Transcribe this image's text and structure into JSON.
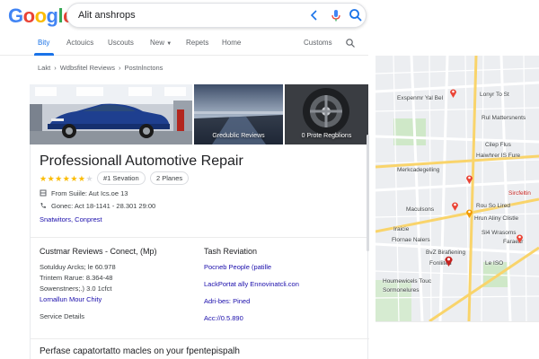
{
  "header": {
    "logo_letters": [
      {
        "char": "G",
        "color": "#4285f4"
      },
      {
        "char": "o",
        "color": "#ea4335"
      },
      {
        "char": "o",
        "color": "#fbbc05"
      },
      {
        "char": "g",
        "color": "#4285f4"
      },
      {
        "char": "l",
        "color": "#34a853"
      },
      {
        "char": "e",
        "color": "#ea4335"
      }
    ],
    "search_query": "Alit anshrops"
  },
  "tabs": {
    "items": [
      "Bity",
      "Actouics",
      "Uscouts",
      "New",
      "Repets",
      "Home",
      "Customs"
    ],
    "new_has_dropdown": true
  },
  "breadcrumb": [
    "Lakt",
    "Wdbsfitel Reviews",
    "Postnlnctons"
  ],
  "photos": {
    "captions": [
      "",
      "Gredublic Reviews",
      "0 Prote Regblions"
    ]
  },
  "business": {
    "title": "Professionall Automotive Repair",
    "rating_filled": 6,
    "rating_total": 7,
    "chips": [
      "#1 Sevation",
      "2 Planes"
    ],
    "address": "From Suiile: Aut Ics.oe 13",
    "phone": "Gonec: Act 18-1141 - 28.301 29:00",
    "link": "Snatwitors, Conprest"
  },
  "details": {
    "left": {
      "title": "Custmar Reviews - Conect, (Mp)",
      "lines": [
        "Sotulduy Arcks; le 60.978",
        "Trintem Rarue: 8.364-48",
        "Sowenstners;.) 3.0 1cfct"
      ],
      "link": "Lornallun Mour Chity",
      "footer": "Service Details"
    },
    "right": {
      "title": "Tash Reviation",
      "lines": [
        "Pocneb People (patille",
        "LackPortat ally Ennovinatcli.con",
        "Adri-bes: Pined",
        "Acc://0.5.890"
      ]
    }
  },
  "bottom_heading": "Perfase capatortatto macles on your fpentepispalh",
  "map": {
    "labels": [
      {
        "text": "Lonyr To St",
        "red": false
      },
      {
        "text": "Exspenmr Yal Bel",
        "red": false
      },
      {
        "text": "Rul Mattersnents",
        "red": false
      },
      {
        "text": "Cilep Flus",
        "red": false
      },
      {
        "text": "Haiwhrer IS Fure",
        "red": false
      },
      {
        "text": "Merkcadegelling",
        "red": false
      },
      {
        "text": "Sircfeltin",
        "red": true
      },
      {
        "text": "Rou So Lired",
        "red": false
      },
      {
        "text": "Maculsons",
        "red": false
      },
      {
        "text": "Hrun Aliny Clistle",
        "red": false
      },
      {
        "text": "Iraicie",
        "red": false
      },
      {
        "text": "Flornae Nalers",
        "red": false
      },
      {
        "text": "Sl4 Wrasoms",
        "red": false
      },
      {
        "text": "Faraeltr",
        "red": false
      },
      {
        "text": "BvZ Birafiening",
        "red": false
      },
      {
        "text": "Fonliited",
        "red": false
      },
      {
        "text": "Le ISO",
        "red": false
      },
      {
        "text": "Houmewicels Touc",
        "red": false
      },
      {
        "text": "Sormonelures",
        "red": false
      }
    ],
    "accent_red": "#ea4335",
    "road_yellow": "#f9d46b"
  }
}
